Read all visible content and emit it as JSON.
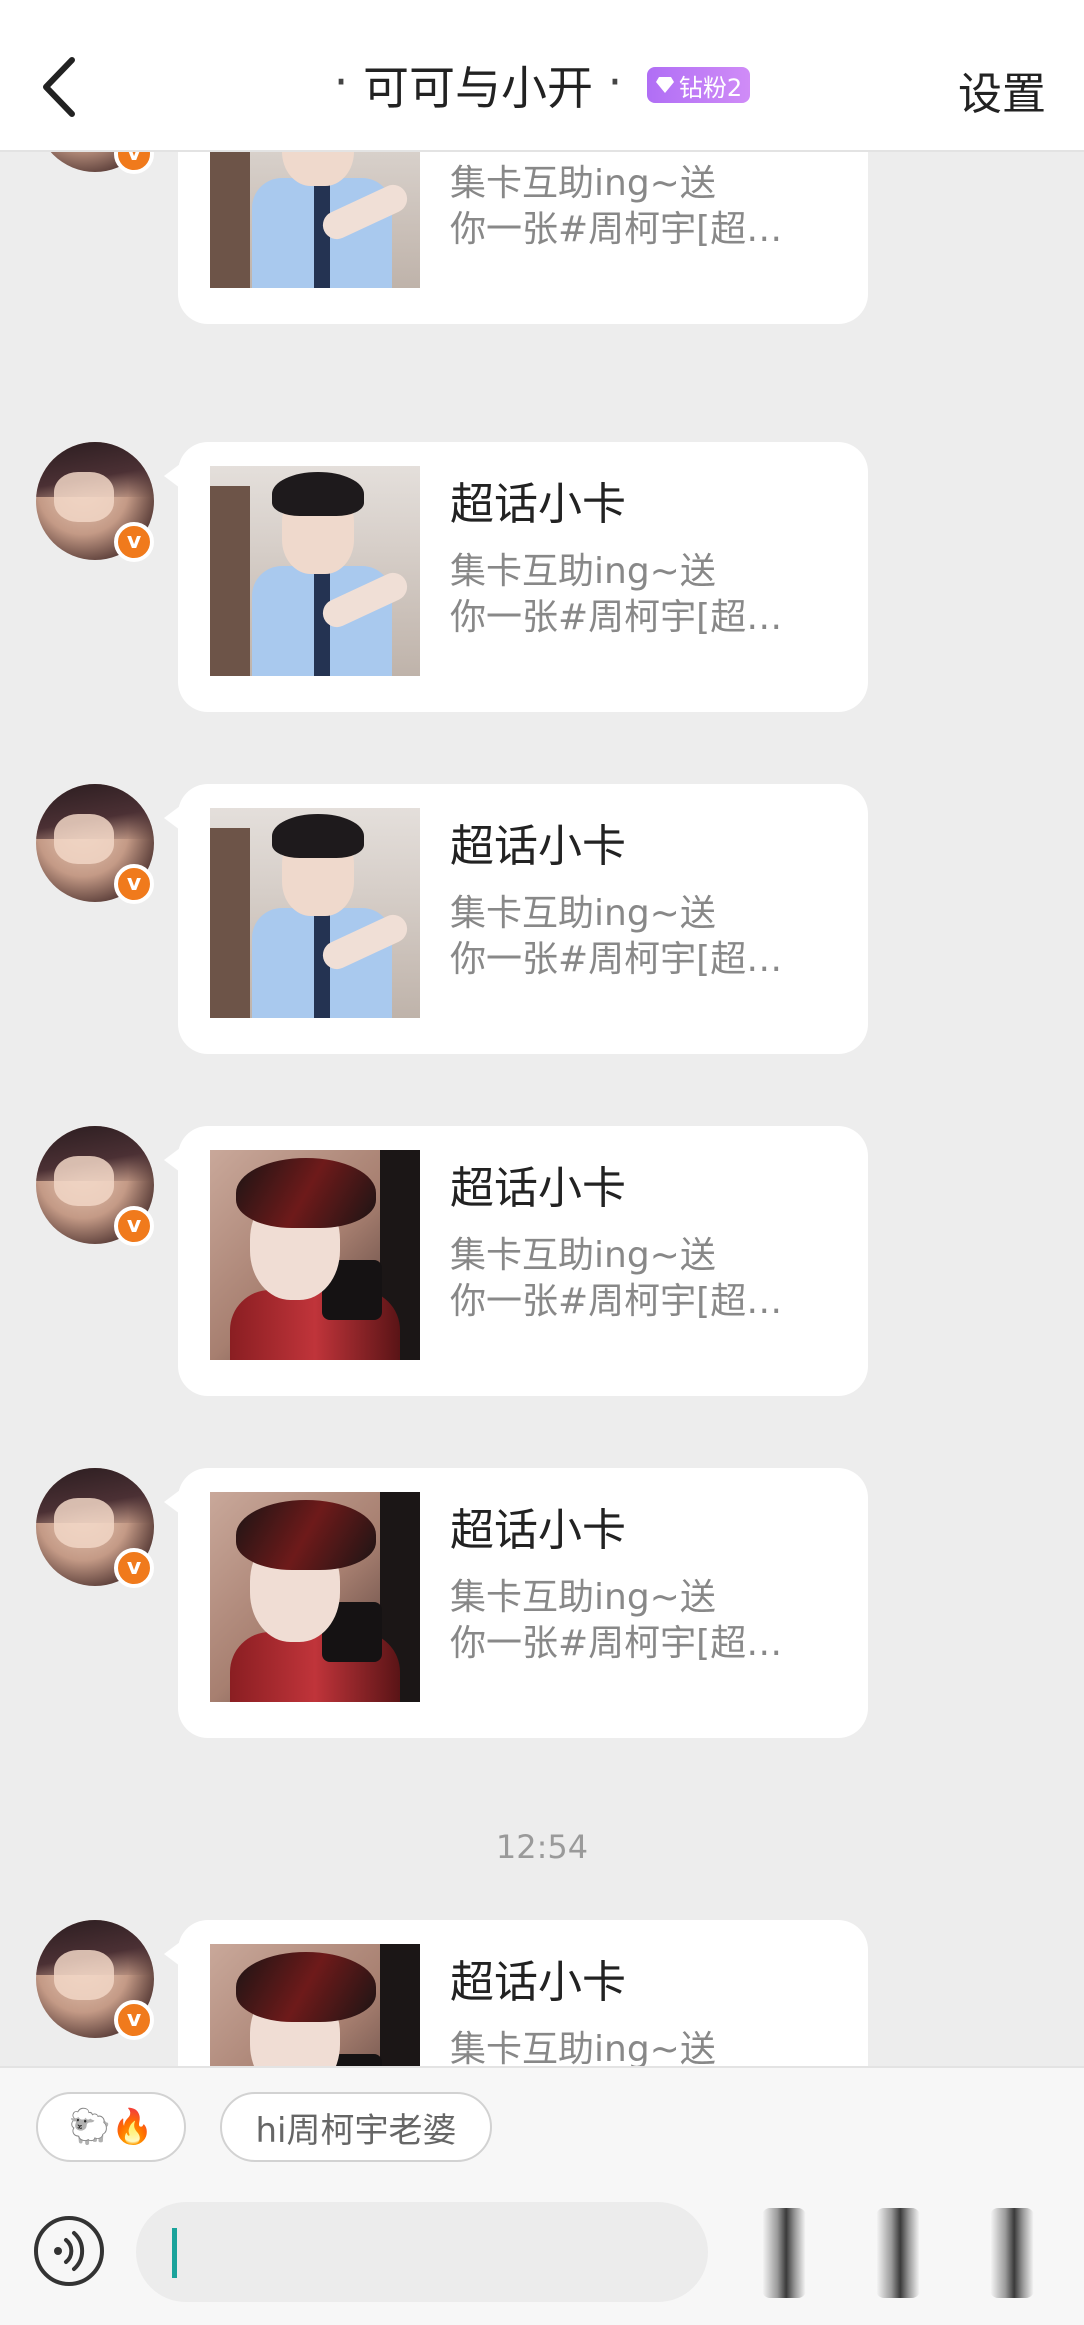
{
  "header": {
    "title": "可可与小开",
    "title_prefix": "·",
    "title_suffix": "·",
    "badge": "钻粉2",
    "settings": "设置"
  },
  "card": {
    "title": "超话小卡",
    "desc_line1": "集卡互助ing~送",
    "desc_line2": "你一张#周柯宇[超…"
  },
  "messages": [
    {
      "thumb": "blue"
    },
    {
      "thumb": "blue"
    },
    {
      "thumb": "blue"
    },
    {
      "thumb": "red"
    },
    {
      "thumb": "red"
    },
    {
      "thumb": "red"
    }
  ],
  "timestamp": "12:54",
  "quick_replies": [
    {
      "label": "🐑🔥"
    },
    {
      "label": "hi周柯宇老婆"
    }
  ],
  "colors": {
    "accent": "#1aa39b",
    "verified": "#f07a1c",
    "badge": "#b06ef5",
    "background": "#ededed"
  },
  "icons": [
    "back-arrow-icon",
    "diamond-icon",
    "verified-icon",
    "voice-icon"
  ]
}
